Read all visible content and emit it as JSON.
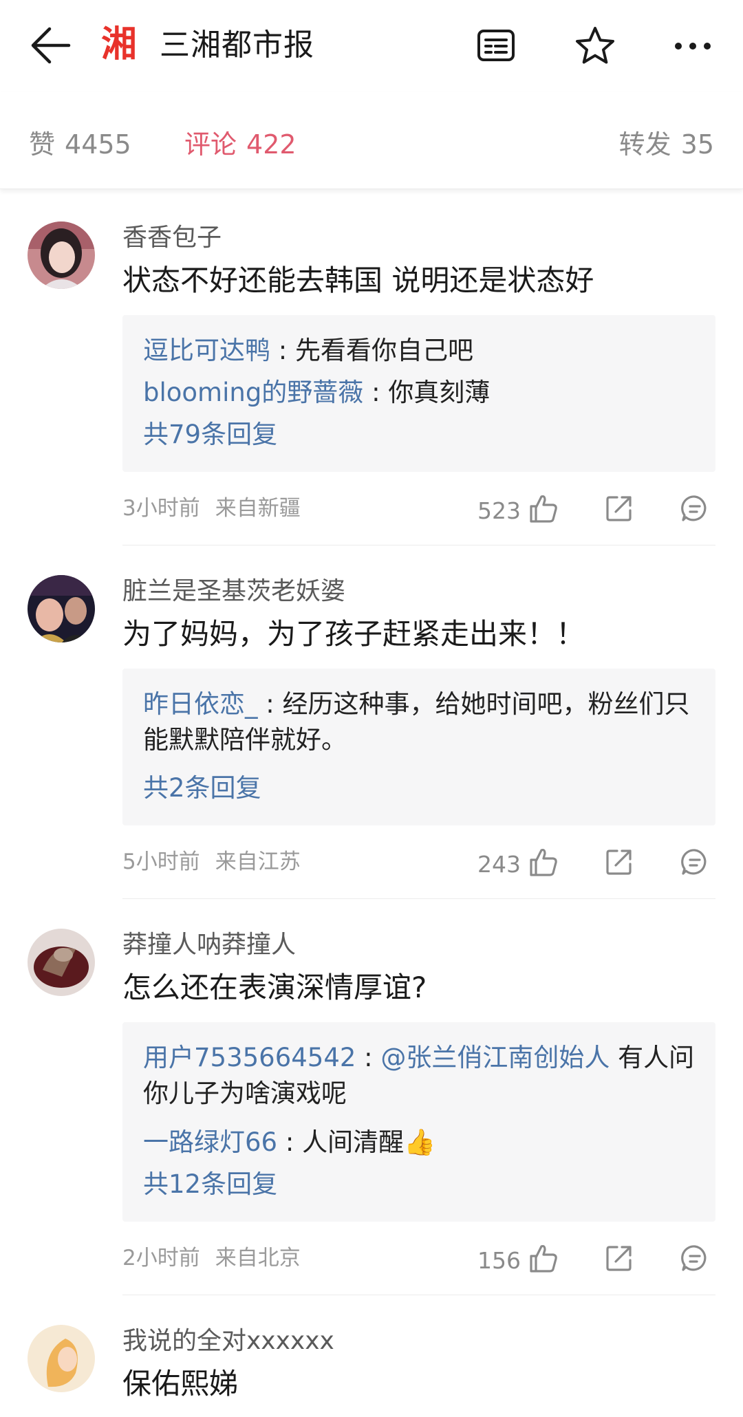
{
  "header": {
    "logo_char": "湘",
    "title": "三湘都市报",
    "brand_color": "#e8322b"
  },
  "stats": {
    "like_label": "赞",
    "like_count": "4455",
    "comment_label": "评论",
    "comment_count": "422",
    "share_label": "转发",
    "share_count": "35",
    "active_color": "#e05a6e"
  },
  "comments": [
    {
      "user": "香香包子",
      "text": "状态不好还能去韩国 说明还是状态好",
      "replies": [
        {
          "user": "逗比可达鸭",
          "sep": " : ",
          "text": "先看看你自己吧"
        },
        {
          "user": "blooming的野蔷薇",
          "sep": " : ",
          "text": "你真刻薄"
        }
      ],
      "more": "共79条回复",
      "time": "3小时前",
      "location": "来自新疆",
      "likes": "523"
    },
    {
      "user": "脏兰是圣基茨老妖婆",
      "text": "为了妈妈，为了孩子赶紧走出来！！",
      "replies": [
        {
          "user": "昨日依恋_",
          "sep": " : ",
          "text": "经历这种事，给她时间吧，粉丝们只能默默陪伴就好。"
        }
      ],
      "more": "共2条回复",
      "time": "5小时前",
      "location": "来自江苏",
      "likes": "243"
    },
    {
      "user": "莽撞人呐莽撞人",
      "text": "怎么还在表演深情厚谊?",
      "replies": [
        {
          "user": "用户7535664542",
          "sep": " : ",
          "mention": "@张兰俏江南创始人",
          "text": " 有人问你儿子为啥演戏呢"
        },
        {
          "user": "一路绿灯66",
          "sep": " : ",
          "text": "人间清醒👍"
        }
      ],
      "more": "共12条回复",
      "time": "2小时前",
      "location": "来自北京",
      "likes": "156"
    },
    {
      "user": "我说的全对xxxxxx",
      "text": "保佑熙娣"
    }
  ],
  "icons": [
    "back-arrow-icon",
    "list-icon",
    "star-icon",
    "more-icon",
    "thumbs-up-icon",
    "share-icon",
    "comment-icon"
  ]
}
